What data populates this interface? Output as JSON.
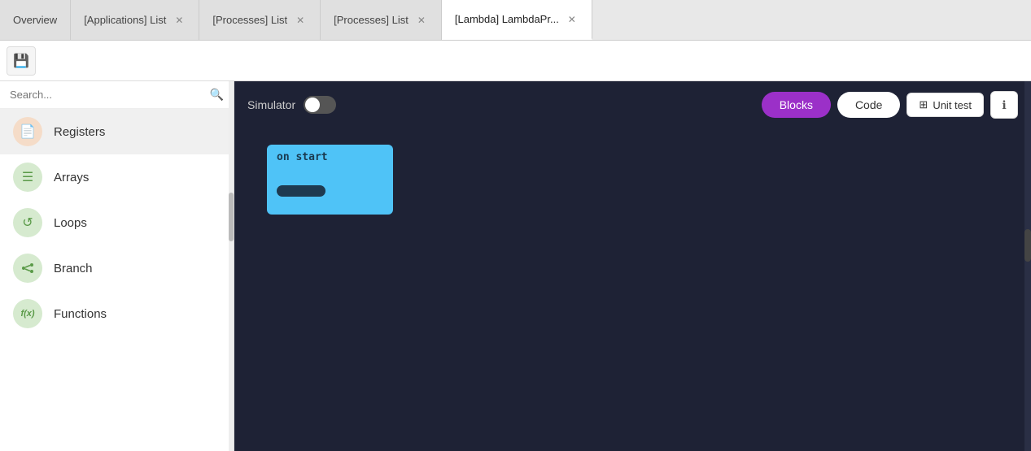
{
  "tabs": [
    {
      "id": "overview",
      "label": "Overview",
      "closable": false,
      "active": false
    },
    {
      "id": "applications-list",
      "label": "[Applications] List",
      "closable": true,
      "active": false
    },
    {
      "id": "processes-list-1",
      "label": "[Processes] List",
      "closable": true,
      "active": false
    },
    {
      "id": "processes-list-2",
      "label": "[Processes] List",
      "closable": true,
      "active": false
    },
    {
      "id": "lambda",
      "label": "[Lambda] LambdaPr...",
      "closable": true,
      "active": true
    }
  ],
  "toolbar": {
    "save_label": "💾"
  },
  "sidebar": {
    "search_placeholder": "Search...",
    "items": [
      {
        "id": "registers",
        "label": "Registers",
        "icon": "📄",
        "icon_class": "icon-registers",
        "active": true
      },
      {
        "id": "arrays",
        "label": "Arrays",
        "icon": "☰",
        "icon_class": "icon-arrays",
        "active": false
      },
      {
        "id": "loops",
        "label": "Loops",
        "icon": "↺",
        "icon_class": "icon-loops",
        "active": false
      },
      {
        "id": "branch",
        "label": "Branch",
        "icon": "⋈",
        "icon_class": "icon-branch",
        "active": false
      },
      {
        "id": "functions",
        "label": "Functions",
        "icon": "f(x)",
        "icon_class": "icon-functions",
        "active": false
      }
    ]
  },
  "content": {
    "simulator_label": "Simulator",
    "blocks_label": "Blocks",
    "code_label": "Code",
    "unit_test_label": "Unit test",
    "info_icon": "ℹ",
    "block_label": "on start"
  }
}
